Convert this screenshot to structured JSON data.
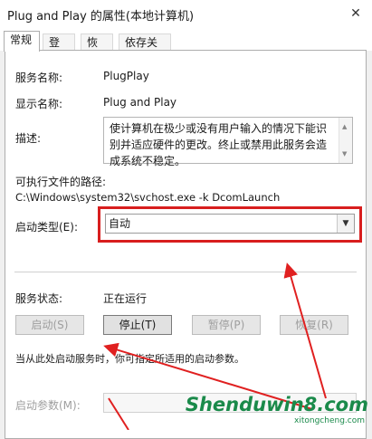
{
  "window": {
    "title": "Plug and Play 的属性(本地计算机)",
    "close_glyph": "✕"
  },
  "tabs": [
    {
      "label": "常规",
      "active": true
    },
    {
      "label": "登录",
      "active": false
    },
    {
      "label": "恢复",
      "active": false
    },
    {
      "label": "依存关系",
      "active": false
    }
  ],
  "general": {
    "service_name_label": "服务名称:",
    "service_name_value": "PlugPlay",
    "display_name_label": "显示名称:",
    "display_name_value": "Plug and Play",
    "description_label": "描述:",
    "description_value": "使计算机在极少或没有用户输入的情况下能识别并适应硬件的更改。终止或禁用此服务会造成系统不稳定。",
    "exe_path_label": "可执行文件的路径:",
    "exe_path_value": "C:\\Windows\\system32\\svchost.exe -k DcomLaunch",
    "startup_type_label": "启动类型(E):",
    "startup_type_value": "自动",
    "service_status_label": "服务状态:",
    "service_status_value": "正在运行",
    "buttons": {
      "start": "启动(S)",
      "stop": "停止(T)",
      "pause": "暂停(P)",
      "resume": "恢复(R)"
    },
    "hint_text": "当从此处启动服务时，你可指定所适用的启动参数。",
    "start_params_label": "启动参数(M):"
  },
  "watermark": {
    "main": "Shenduwin8.com",
    "sub": "xitongcheng.com"
  },
  "colors": {
    "highlight": "#d81e1e",
    "watermark": "#1a8a4a"
  },
  "icons": {
    "dropdown": "chevron-down",
    "scroll_up": "triangle-up",
    "scroll_down": "triangle-down",
    "close": "x"
  }
}
